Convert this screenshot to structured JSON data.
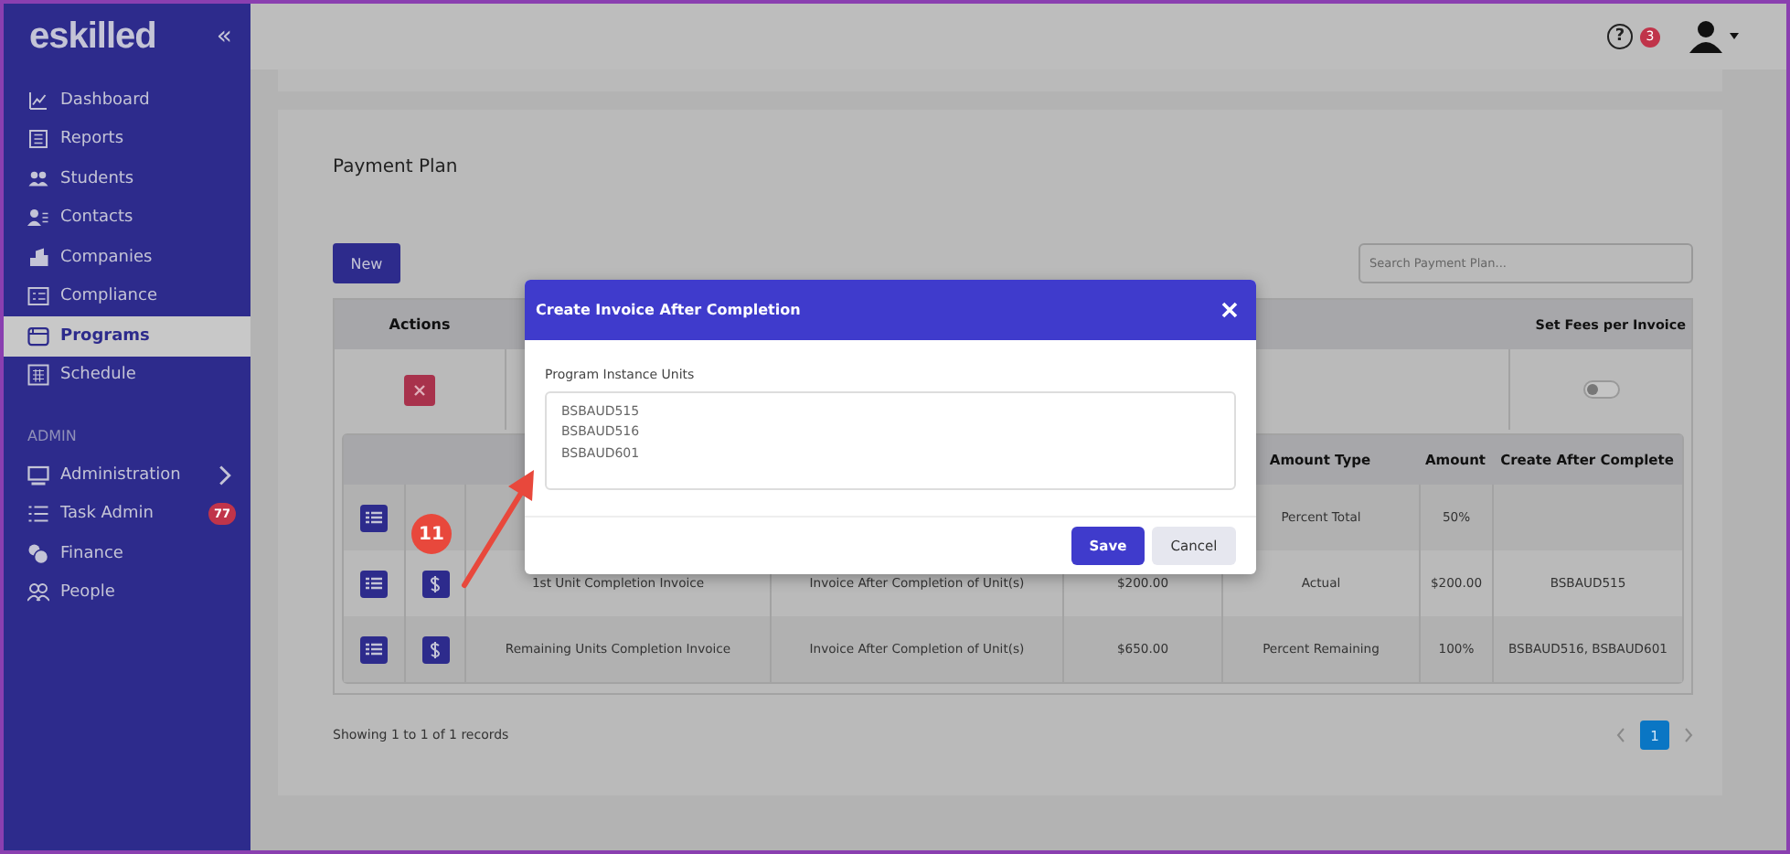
{
  "sidebar": {
    "logo": "eskilled",
    "collapse": "«",
    "items": [
      {
        "label": "Dashboard",
        "selected": false
      },
      {
        "label": "Reports",
        "selected": false
      },
      {
        "label": "Students",
        "selected": false
      },
      {
        "label": "Contacts",
        "selected": false
      },
      {
        "label": "Companies",
        "selected": false
      },
      {
        "label": "Compliance",
        "selected": false
      },
      {
        "label": "Programs",
        "selected": true
      },
      {
        "label": "Schedule",
        "selected": false
      }
    ],
    "admin_heading": "ADMIN",
    "admin_items": [
      {
        "label": "Administration",
        "selected": false,
        "expandable": true
      },
      {
        "label": "Task Admin",
        "selected": false,
        "expandable": false,
        "badge": "77"
      },
      {
        "label": "Finance",
        "selected": false,
        "expandable": false
      },
      {
        "label": "People",
        "selected": false,
        "expandable": false
      }
    ]
  },
  "topbar": {
    "help": "?",
    "notifications": "3"
  },
  "payment_plan": {
    "title": "Payment Plan",
    "new_button": "New",
    "search": {
      "placeholder": "Search Payment Plan..."
    },
    "actions_header": "Actions",
    "fees_header": "Set Fees per Invoice",
    "set_fees_on": false,
    "units_table": {
      "headers": {
        "amount_type": "Amount Type",
        "amount": "Amount",
        "create_after": "Create After Complete"
      },
      "rows": [
        {
          "invoice_button": false,
          "amount_type": "Percent Total",
          "amount": "50%"
        },
        {
          "invoice_button": true,
          "name": "1st Unit Completion Invoice",
          "type": "Invoice After Completion of Unit(s)",
          "fee": "$200.00",
          "amount_type": "Actual",
          "amount": "$200.00",
          "create_after": "BSBAUD515"
        },
        {
          "invoice_button": true,
          "name": "Remaining Units Completion Invoice",
          "type": "Invoice After Completion of Unit(s)",
          "fee": "$650.00",
          "amount_type": "Percent Remaining",
          "amount": "100%",
          "create_after": "BSBAUD516, BSBAUD601"
        }
      ]
    },
    "records": "Showing 1 to 1 of 1 records",
    "pages": [
      {
        "label": "1",
        "selected": true
      }
    ]
  },
  "modal": {
    "title": "Create Invoice After Completion",
    "field_label": "Program Instance Units",
    "units": [
      "BSBAUD515",
      "BSBAUD516",
      "BSBAUD601"
    ],
    "buttons": [
      {
        "label": "Save",
        "kind": "primary"
      },
      {
        "label": "Cancel",
        "kind": "secondary"
      }
    ]
  },
  "annotation": {
    "step": "11"
  }
}
